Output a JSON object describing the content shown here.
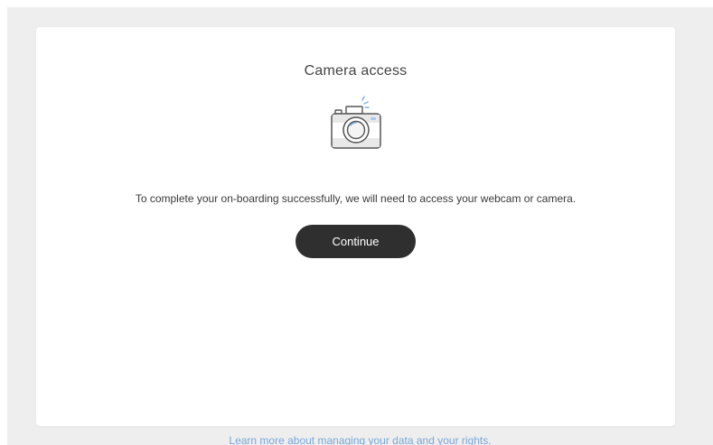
{
  "card": {
    "title": "Camera access",
    "message": "To complete your on-boarding successfully, we will need to access your webcam or camera.",
    "continue_label": "Continue",
    "icon": "camera-icon"
  },
  "footer": {
    "link_text": "Learn more about managing your data and your rights."
  },
  "colors": {
    "background": "#eeeeee",
    "card": "#ffffff",
    "button": "#2f2f2f",
    "link": "#7aa7d9"
  }
}
